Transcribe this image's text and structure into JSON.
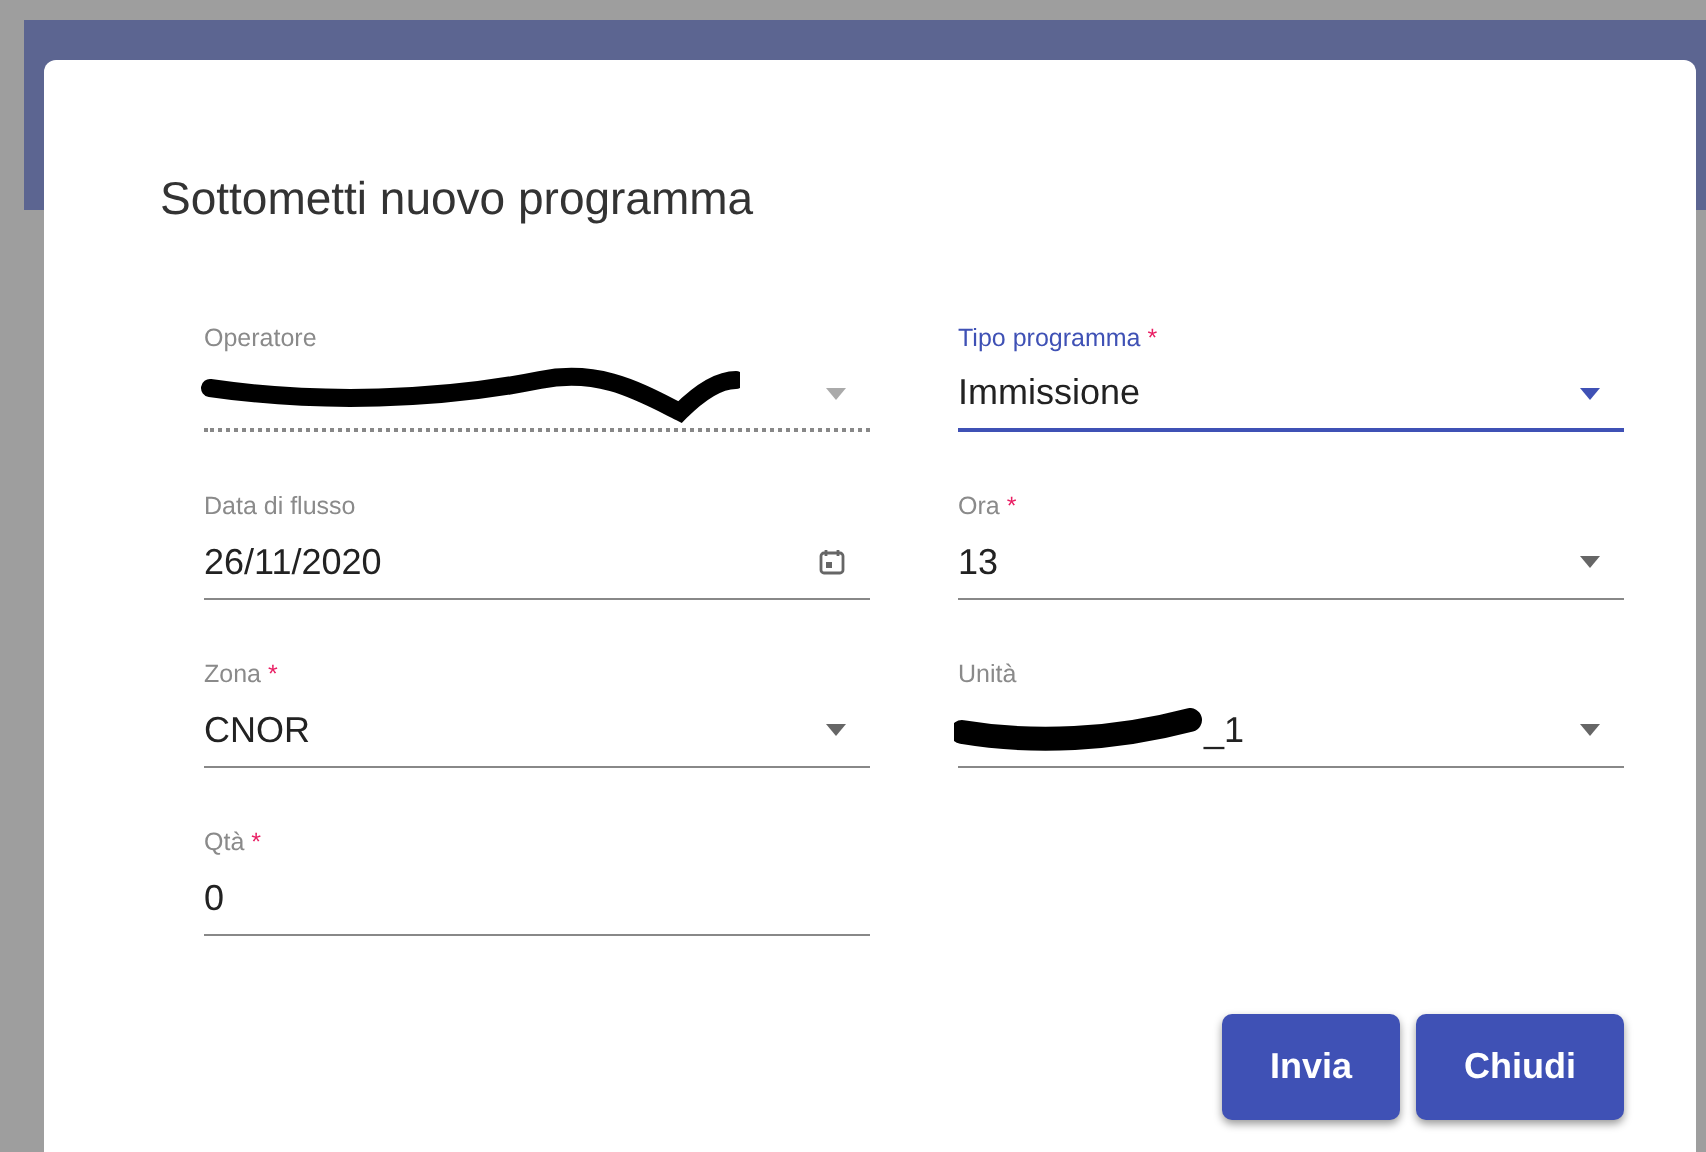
{
  "dialog": {
    "title": "Sottometti nuovo programma",
    "fields": [
      {
        "label": "Operatore",
        "kind": "select",
        "disabled": true,
        "focused": false,
        "redacted": true
      },
      {
        "label": "Tipo programma",
        "required_mark": "*",
        "kind": "select",
        "disabled": false,
        "focused": true,
        "value": "Immissione"
      },
      {
        "label": "Data di flusso",
        "kind": "date",
        "disabled": false,
        "focused": false,
        "value": "26/11/2020"
      },
      {
        "label": "Ora",
        "required_mark": "*",
        "kind": "select",
        "disabled": false,
        "focused": false,
        "value": "13"
      },
      {
        "label": "Zona",
        "required_mark": "*",
        "kind": "select",
        "disabled": false,
        "focused": false,
        "value": "CNOR"
      },
      {
        "label": "Unità",
        "kind": "select",
        "disabled": false,
        "focused": false,
        "redacted": true,
        "value": "_1"
      },
      {
        "label": "Qtà",
        "required_mark": "*",
        "kind": "text",
        "disabled": false,
        "focused": false,
        "value": "0"
      }
    ],
    "buttons": [
      "Invia",
      "Chiudi"
    ]
  }
}
